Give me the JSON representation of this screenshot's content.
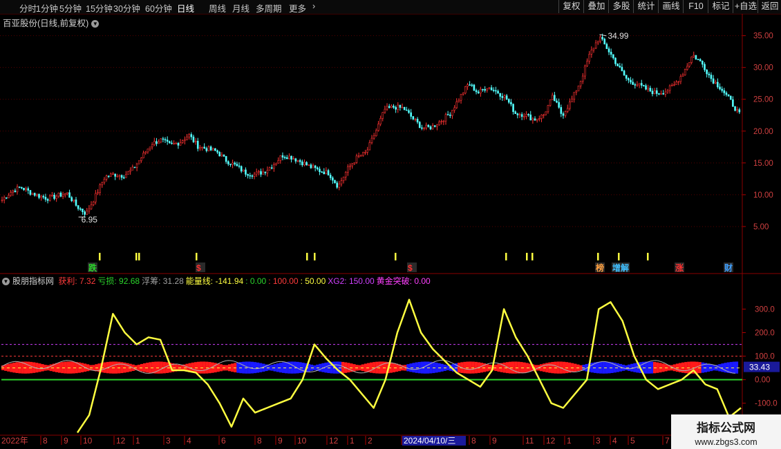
{
  "toolbar": {
    "periods": [
      "分时",
      "1分钟",
      "5分钟",
      "15分钟",
      "30分钟",
      "60分钟",
      "日线",
      "周线",
      "月线",
      "多周期",
      "更多"
    ],
    "active_period": "日线",
    "buttons": [
      "复权",
      "叠加",
      "多股",
      "统计",
      "画线",
      "F10",
      "标记",
      "+自选",
      "返回"
    ]
  },
  "chart_title": "百亚股份(日线,前复权)",
  "indicator": {
    "name": "股朋指标网",
    "legend": [
      {
        "label": "获利:",
        "value": "7.32",
        "color": "#ff3b3b"
      },
      {
        "label": "亏损:",
        "value": "92.68",
        "color": "#2bd52b"
      },
      {
        "label": "浮筹:",
        "value": "31.28",
        "color": "#a0a0a0"
      },
      {
        "label": "能量线:",
        "value": "-141.94",
        "color": "#ffff40"
      },
      {
        "label": ":",
        "value": "0.00",
        "color": "#2bd52b"
      },
      {
        "label": ":",
        "value": "100.00",
        "color": "#ff3b3b"
      },
      {
        "label": ":",
        "value": "50.00",
        "color": "#ffff40"
      },
      {
        "label": "XG2:",
        "value": "150.00",
        "color": "#d040ff"
      },
      {
        "label": "黄金突破:",
        "value": "0.00",
        "color": "#ff40ff"
      }
    ],
    "current_value_label": "33.43"
  },
  "watermark": {
    "line1": "指标公式网",
    "line2": "www.zbgs3.com"
  },
  "chart_data": [
    {
      "type": "candlestick",
      "title": "百亚股份(日线,前复权)",
      "ylim": [
        0,
        38
      ],
      "y_ticks": [
        "35.00",
        "30.00",
        "25.00",
        "20.00",
        "15.00",
        "10.00",
        "5.00"
      ],
      "y_tick_values": [
        35,
        30,
        25,
        20,
        15,
        10,
        5
      ],
      "annotations": [
        {
          "label": "6.95",
          "kind": "low"
        },
        {
          "label": "34.99",
          "kind": "high"
        }
      ],
      "close_path": [
        9.2,
        10.5,
        11.2,
        10.4,
        9.8,
        9.4,
        9.9,
        10.2,
        8.2,
        7.0,
        9.8,
        12.8,
        13.2,
        13.0,
        14.0,
        16.0,
        18.0,
        18.6,
        17.8,
        18.2,
        19.4,
        17.6,
        17.2,
        16.8,
        15.4,
        14.6,
        13.5,
        13.2,
        13.6,
        14.6,
        16.2,
        15.9,
        15.2,
        14.4,
        13.8,
        13.4,
        11.3,
        14.0,
        15.8,
        16.6,
        19.8,
        23.4,
        23.8,
        23.6,
        22.0,
        20.5,
        20.6,
        21.6,
        22.8,
        25.2,
        27.5,
        26.0,
        27.0,
        26.2,
        25.2,
        22.8,
        22.6,
        21.8,
        22.5,
        25.4,
        22.5,
        24.8,
        28.0,
        32.2,
        34.8,
        32.6,
        30.2,
        28.0,
        27.4,
        26.6,
        26.0,
        26.2,
        27.2,
        29.2,
        32.0,
        30.6,
        28.2,
        26.8,
        24.8,
        22.6
      ],
      "signal_markers": [
        {
          "label": "跌",
          "color": "#2bd52b"
        },
        {
          "label": "$",
          "color": "#ff3030"
        },
        {
          "label": "$",
          "color": "#ff3030"
        },
        {
          "label": "榜",
          "color": "#ffa040"
        },
        {
          "label": "增解",
          "color": "#40c0ff"
        },
        {
          "label": "涨",
          "color": "#ff3030"
        },
        {
          "label": "财",
          "color": "#40a0ff"
        }
      ]
    },
    {
      "type": "line",
      "title": "股朋指标网",
      "ylim": [
        -230,
        410
      ],
      "y_ticks": [
        "300.0",
        "200.0",
        "100.0",
        "0.00",
        "-100.0"
      ],
      "y_tick_values": [
        300,
        200,
        100,
        0,
        -100
      ],
      "reference_lines": [
        {
          "value": 0,
          "color": "#2bd52b"
        },
        {
          "value": 100,
          "color": "#ff3b3b"
        },
        {
          "value": 50,
          "color": "#ffff40"
        },
        {
          "value": 150,
          "color": "#d040ff"
        }
      ],
      "series": [
        {
          "name": "能量线",
          "color": "#ffff40",
          "values": [
            -250,
            -150,
            50,
            280,
            200,
            150,
            180,
            170,
            40,
            40,
            30,
            -20,
            -100,
            -200,
            -80,
            -140,
            -120,
            -100,
            -80,
            0,
            150,
            90,
            40,
            0,
            -60,
            -120,
            0,
            200,
            340,
            200,
            130,
            80,
            30,
            0,
            -30,
            40,
            300,
            180,
            100,
            0,
            -100,
            -120,
            -60,
            0,
            300,
            330,
            250,
            100,
            0,
            -40,
            -20,
            0,
            40,
            -20,
            -40,
            -160,
            -120
          ]
        }
      ],
      "x_tick_labels": [
        "2022年",
        "8",
        "9",
        "10",
        "12",
        "1",
        "3",
        "4",
        "6",
        "8",
        "9",
        "10",
        "12",
        "1",
        "2",
        "2024/04/10/三",
        "8",
        "9",
        "11",
        "12",
        "1",
        "3",
        "4",
        "5",
        "7"
      ]
    }
  ]
}
